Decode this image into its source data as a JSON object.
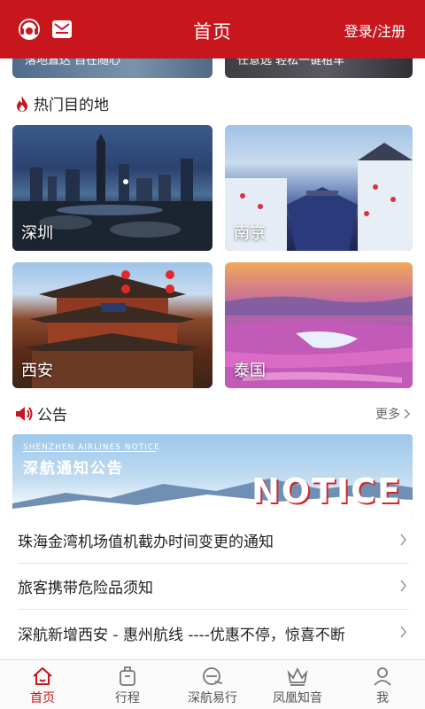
{
  "header": {
    "title": "首页",
    "login_label": "登录/注册",
    "icons": [
      "customer-service-icon",
      "message-icon"
    ]
  },
  "banners": {
    "left_text": "落地直达 自在随心",
    "right_text": "任意选 轻松一键租车"
  },
  "hot_destinations": {
    "title": "热门目的地",
    "items": [
      {
        "label": "深圳"
      },
      {
        "label": "南京"
      },
      {
        "label": "西安"
      },
      {
        "label": "泰国"
      }
    ]
  },
  "notice": {
    "title": "公告",
    "more_label": "更多",
    "banner_sub": "SHENZHEN AIRLINES NOTICE",
    "banner_title": "深航通知公告",
    "banner_big": "NOTICE",
    "items": [
      {
        "text": "珠海金湾机场值机截办时间变更的通知"
      },
      {
        "text": "旅客携带危险品须知"
      },
      {
        "text": "深航新增西安 - 惠州航线  ----优惠不停，惊喜不断"
      }
    ]
  },
  "tabbar": {
    "tabs": [
      {
        "label": "首页",
        "icon": "home-icon",
        "active": true
      },
      {
        "label": "行程",
        "icon": "luggage-icon",
        "active": false
      },
      {
        "label": "深航易行",
        "icon": "easy-travel-icon",
        "active": false
      },
      {
        "label": "凤凰知音",
        "icon": "crown-icon",
        "active": false
      },
      {
        "label": "我",
        "icon": "person-icon",
        "active": false
      }
    ]
  },
  "colors": {
    "brand_red": "#c8161d",
    "text": "#222222",
    "muted": "#666666"
  }
}
